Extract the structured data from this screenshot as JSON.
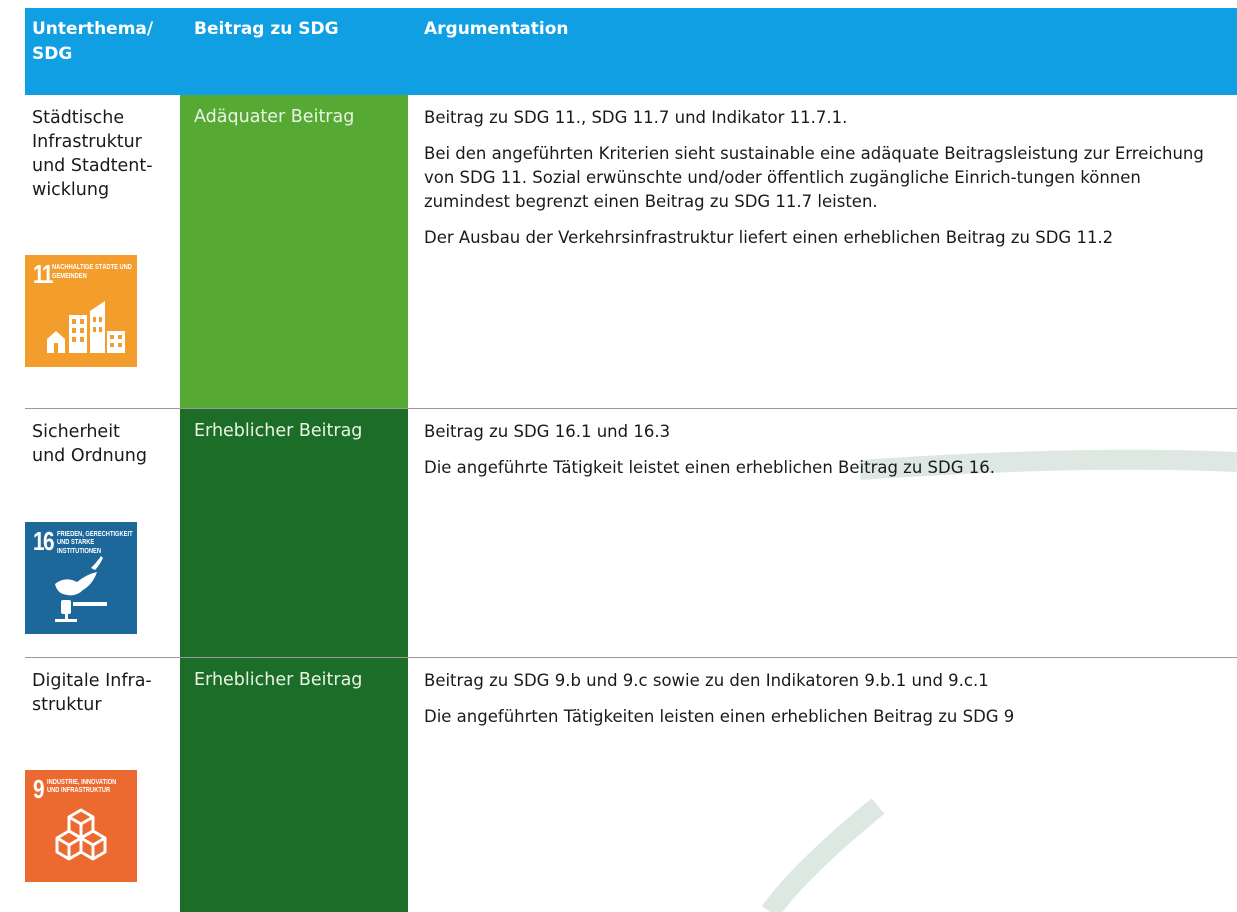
{
  "header": {
    "col1": "Unterthema/ SDG",
    "col2": "Beitrag zu SDG",
    "col3": "Argumentation"
  },
  "colors": {
    "header": "#0f9fe2",
    "adequate": "#56aa34",
    "substantial": "#1c6d27",
    "sdg11": "#f39d2d",
    "sdg16": "#1d689b",
    "sdg9": "#ec6a2f",
    "swoosh": "#dde8e3"
  },
  "rows": [
    {
      "topic": "Städtische Infrastruktur und Stadtent-wicklung",
      "icon": {
        "name": "sdg-11-cities-icon",
        "number": "11",
        "label": "NACHHALTIGE STÄDTE UND GEMEINDEN"
      },
      "contribution": "Adäquater Beitrag",
      "argument": [
        "Beitrag zu SDG 11., SDG 11.7 und Indikator 11.7.1.",
        "Bei den angeführten Kriterien sieht sustainable eine adäquate Beitragsleistung zur Erreichung von SDG 11. Sozial erwünschte und/oder öffentlich zugängliche Einrich-tungen können zumindest begrenzt einen Beitrag zu SDG 11.7 leisten.",
        "Der Ausbau der Verkehrsinfrastruktur liefert einen erheblichen Beitrag zu SDG 11.2"
      ]
    },
    {
      "topic": "Sicherheit und Ordnung",
      "icon": {
        "name": "sdg-16-peace-icon",
        "number": "16",
        "label": "FRIEDEN, GERECHTIGKEIT UND STARKE INSTITUTIONEN"
      },
      "contribution": "Erheblicher Beitrag",
      "argument": [
        "Beitrag zu SDG 16.1 und 16.3",
        "Die angeführte Tätigkeit leistet einen erheblichen Beitrag zu SDG 16."
      ]
    },
    {
      "topic": "Digitale Infra-struktur",
      "icon": {
        "name": "sdg-9-industry-icon",
        "number": "9",
        "label": "INDUSTRIE, INNOVATION UND INFRASTRUKTUR"
      },
      "contribution": "Erheblicher Beitrag",
      "argument": [
        "Beitrag zu SDG 9.b und 9.c sowie zu den Indikatoren 9.b.1 und 9.c.1",
        "Die angeführten Tätigkeiten leisten einen erheblichen Beitrag zu SDG 9"
      ]
    }
  ]
}
